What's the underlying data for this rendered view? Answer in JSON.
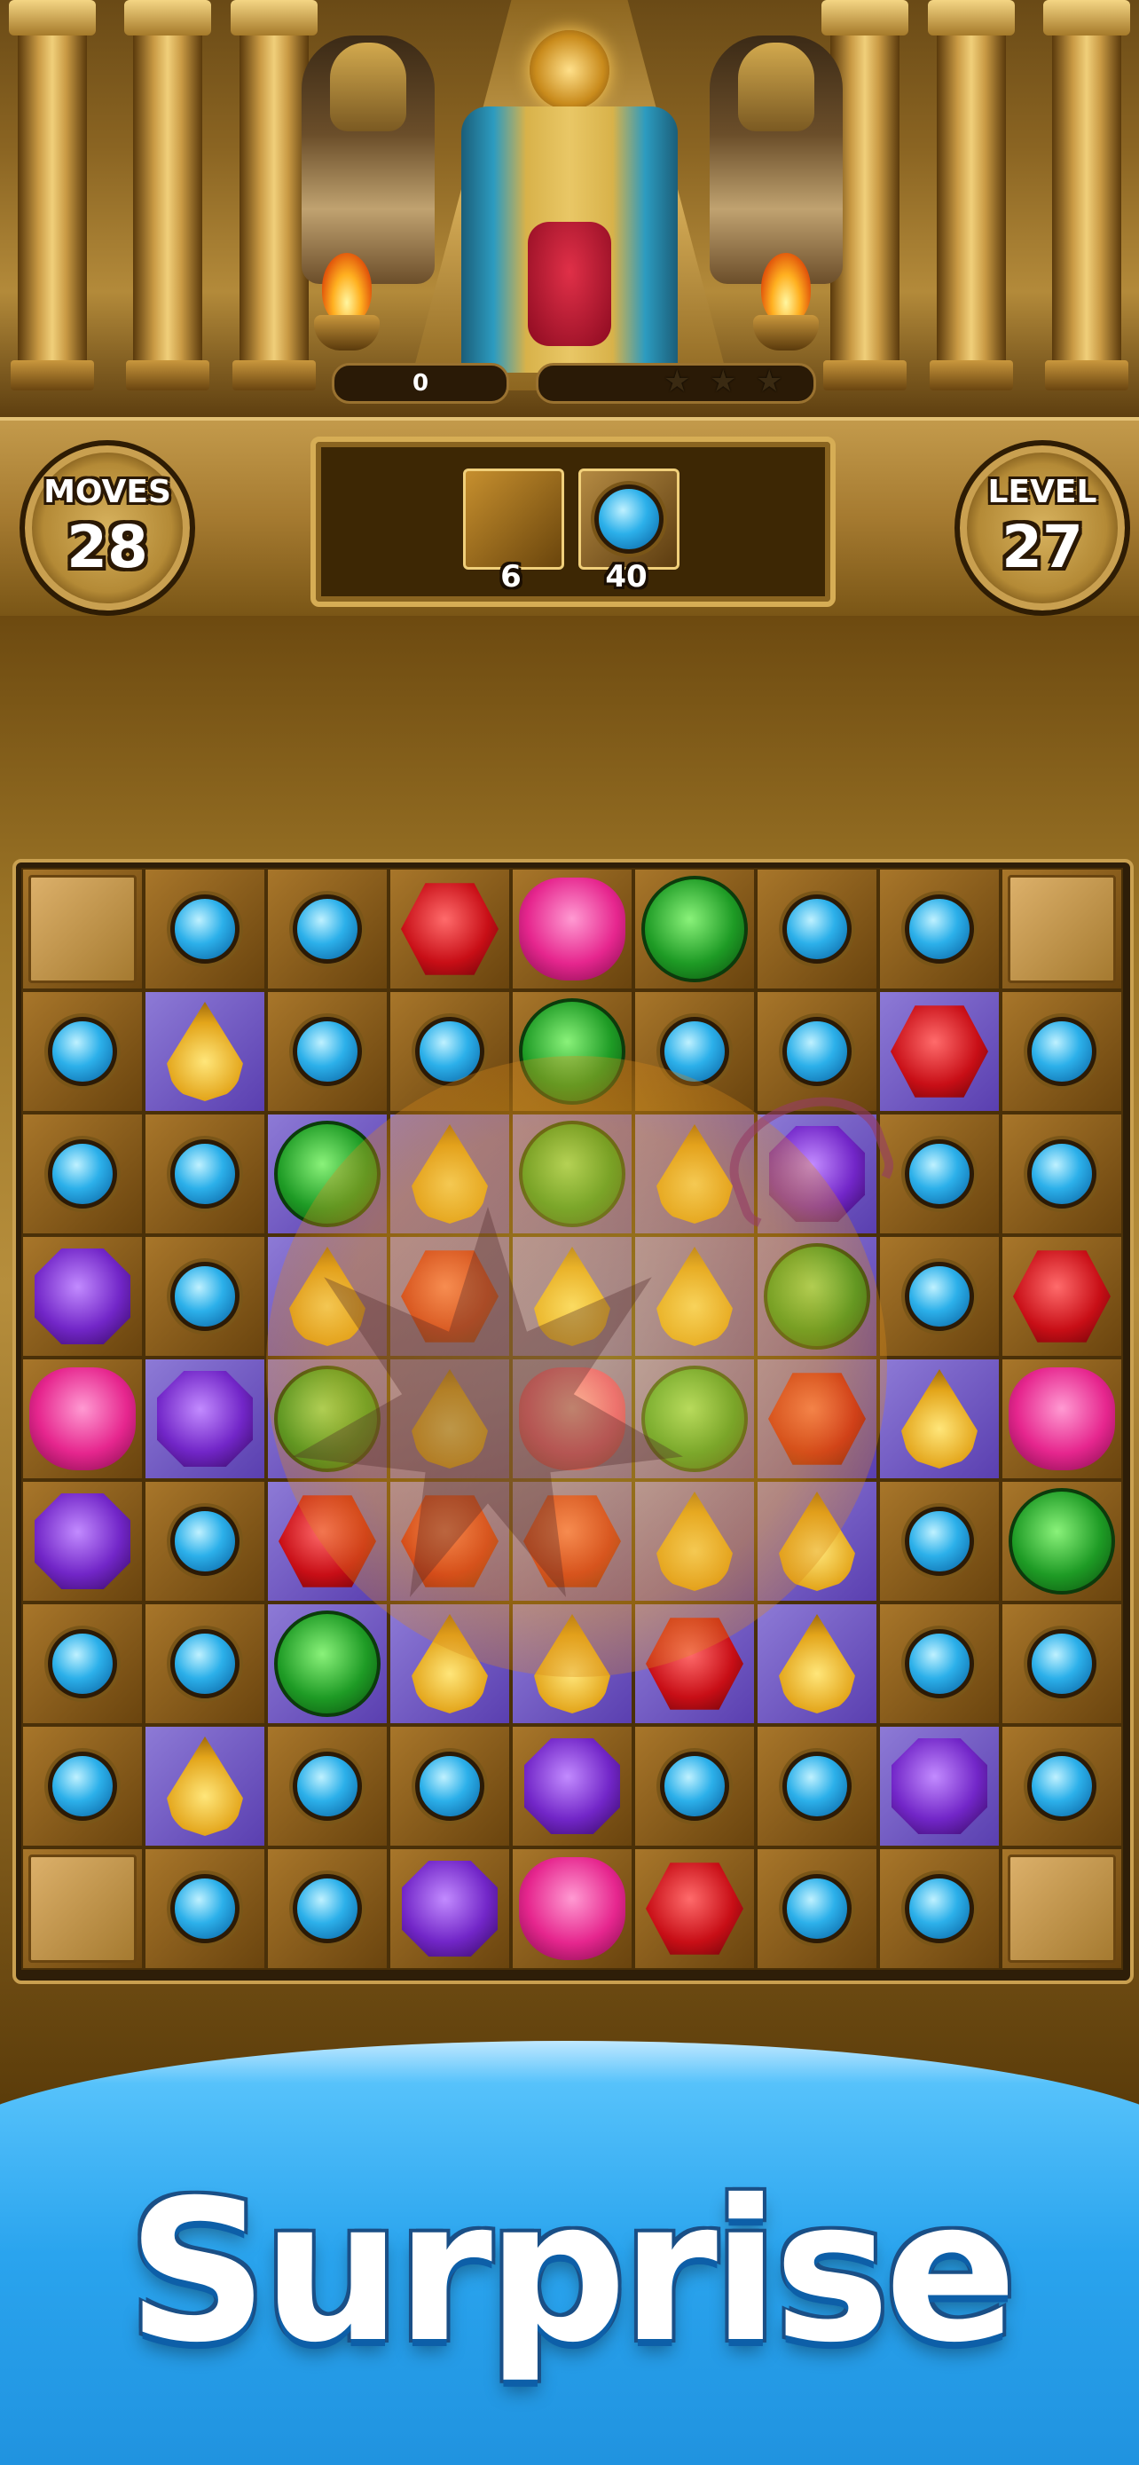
{
  "hud": {
    "moves_label": "MOVES",
    "moves_value": "28",
    "level_label": "LEVEL",
    "level_value": "27",
    "score": "0",
    "star_progress": 0,
    "goals": [
      {
        "icon": "sandstone-tile-icon",
        "count": "6"
      },
      {
        "icon": "blue-gem-icon",
        "count": "40"
      }
    ]
  },
  "board": {
    "rows": 9,
    "cols": 9,
    "grid": [
      [
        "tile",
        "blue",
        "blue",
        "red",
        "pink",
        "green",
        "blue",
        "blue",
        "tile"
      ],
      [
        "blue",
        "yellow",
        "blue",
        "blue",
        "green",
        "blue",
        "blue",
        "red",
        "blue"
      ],
      [
        "blue",
        "blue",
        "green",
        "yellow",
        "green",
        "yellow",
        "purple",
        "blue",
        "blue"
      ],
      [
        "purple",
        "blue",
        "yellow",
        "red",
        "yellow",
        "yellow",
        "green",
        "blue",
        "red"
      ],
      [
        "pink",
        "purple",
        "green",
        "yellow",
        "pink",
        "green",
        "red",
        "yellow",
        "pink"
      ],
      [
        "purple",
        "blue",
        "red",
        "red",
        "red",
        "yellow",
        "yellow",
        "blue",
        "green"
      ],
      [
        "blue",
        "blue",
        "green",
        "yellow",
        "yellow",
        "red",
        "yellow",
        "blue",
        "blue"
      ],
      [
        "blue",
        "yellow",
        "blue",
        "blue",
        "purple",
        "blue",
        "blue",
        "purple",
        "blue"
      ],
      [
        "tile",
        "blue",
        "blue",
        "purple",
        "pink",
        "red",
        "blue",
        "blue",
        "tile"
      ]
    ]
  },
  "banner": {
    "text": "Surprise"
  },
  "colors": {
    "banner_blue": "#2aa4ee",
    "gold": "#c9a050"
  }
}
